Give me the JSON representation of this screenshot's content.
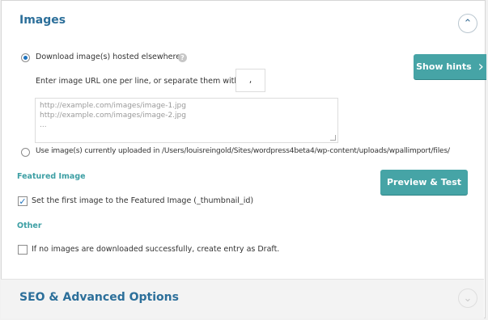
{
  "images_section": {
    "title": "Images",
    "collapse_icon": "chevron-up-icon",
    "download_option": {
      "label": "Download image(s) hosted elsewhere",
      "selected": true,
      "help_icon": "question-mark-icon",
      "help_glyph": "?"
    },
    "url_instruction": "Enter image URL one per line, or separate them with a",
    "separator_value": ",",
    "url_textarea": {
      "placeholder_lines": [
        "http://example.com/images/image-1.jpg",
        "http://example.com/images/image-2.jpg",
        "..."
      ]
    },
    "uploaded_option": {
      "label": "Use image(s) currently uploaded in /Users/louisreingold/Sites/wordpress4beta4/wp-content/uploads/wpallimport/files/",
      "selected": false
    },
    "featured_image": {
      "heading": "Featured Image",
      "checkbox_label": "Set the first image to the Featured Image (_thumbnail_id)",
      "checked": true
    },
    "other": {
      "heading": "Other",
      "checkbox_label": "If no images are downloaded successfully, create entry as Draft.",
      "checked": false
    }
  },
  "buttons": {
    "show_hints": "Show hints",
    "show_hints_icon": "chevron-right-icon",
    "preview_test": "Preview & Test"
  },
  "seo_section": {
    "title": "SEO & Advanced Options",
    "expand_icon": "chevron-down-icon"
  },
  "colors": {
    "accent_teal": "#46a4a6",
    "heading_blue": "#2c6f9a",
    "subheading_teal": "#3d9fa4"
  }
}
